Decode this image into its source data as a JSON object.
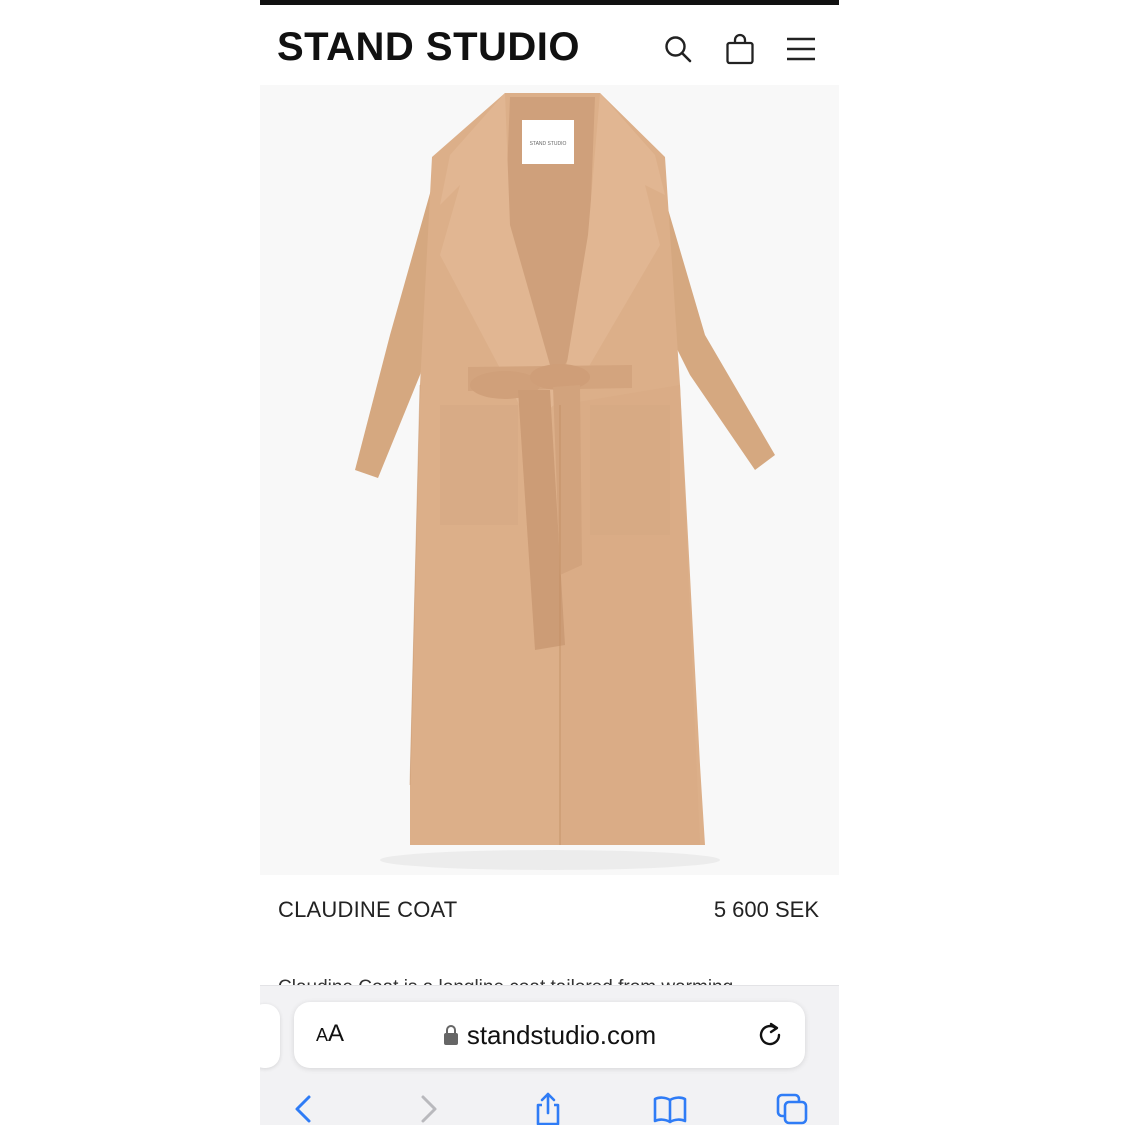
{
  "header": {
    "logo_text": "STAND STUDIO",
    "icons": [
      "search-icon",
      "shopping-bag-icon",
      "hamburger-menu-icon"
    ]
  },
  "product": {
    "name": "CLAUDINE COAT",
    "price": "5 600 SEK",
    "description": "Claudine Coat is a longline coat tailored from warming",
    "image_label_text": "STAND STUDIO",
    "coat_color": "#d8ab86"
  },
  "browser": {
    "text_size_label_large": "A",
    "text_size_label_small": "A",
    "url": "standstudio.com",
    "accent_color": "#2f7cf6",
    "toolbar_icons": [
      "back-icon",
      "forward-icon",
      "share-icon",
      "bookmarks-icon",
      "tabs-icon"
    ]
  }
}
